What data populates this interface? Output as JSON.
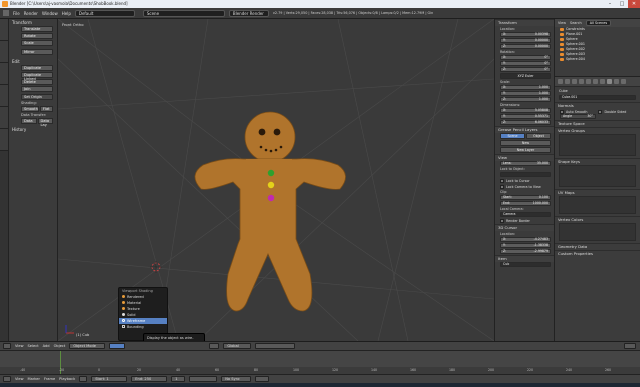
{
  "window": {
    "title": "Blender [C:\\Users\\aj-vasmola\\Documents\\ShobBook.blend]",
    "min": "–",
    "max": "□",
    "close": "✕"
  },
  "infobar": {
    "menus": [
      "File",
      "Render",
      "Window",
      "Help"
    ],
    "layout": "Default",
    "scene": "Scene",
    "engine": "Blender Render",
    "stats": "v2.79 | Verts:29,050 | Faces:28,038 | Tris:56,076 | Objects:0/8 | Lamps:0/2 | Mem:12.79M | Gin"
  },
  "toolshelf": {
    "transform_header": "Transform",
    "transform": [
      "Translate",
      "Rotate",
      "Scale",
      "Mirror"
    ],
    "edit_header": "Edit",
    "edit": [
      "Duplicate",
      "Duplicate Linked",
      "Delete",
      "Join"
    ],
    "set_origin": "Set Origin",
    "shading_label": "Shading:",
    "shading": [
      "Smooth",
      "Flat"
    ],
    "data_transfer_label": "Data Transfer:",
    "data_transfer": [
      "Data",
      "Data Lay"
    ],
    "history": "History"
  },
  "viewport": {
    "label": "Front Ortho",
    "object_label": "(1) Cub"
  },
  "shading_menu": {
    "title": "Viewport Shading",
    "items": [
      "Rendered",
      "Material",
      "Texture",
      "Solid",
      "Wireframe",
      "Bounding"
    ],
    "selected": "Wireframe"
  },
  "tooltip": "Display the object as wire-edges.",
  "npanel": {
    "transform": "Transform",
    "location": "Location:",
    "loc": [
      [
        "X:",
        "0.00398"
      ],
      [
        "Y:",
        "0.00000"
      ],
      [
        "Z:",
        "0.00000"
      ]
    ],
    "rotation": "Rotation:",
    "rot": [
      [
        "X:",
        "0°"
      ],
      [
        "Y:",
        "0°"
      ],
      [
        "Z:",
        "0°"
      ]
    ],
    "euler": "XYZ Euler",
    "scale": "Scale:",
    "scl": [
      [
        "X:",
        "1.000"
      ],
      [
        "Y:",
        "1.000"
      ],
      [
        "Z:",
        "1.000"
      ]
    ],
    "dimensions": "Dimensions:",
    "dim": [
      [
        "X:",
        "5.05808"
      ],
      [
        "Y:",
        "0.55371"
      ],
      [
        "Z:",
        "6.06033"
      ]
    ],
    "grease": "Grease Pencil Layers",
    "scene_btn": "Scene",
    "object_btn": "Object",
    "new": "New",
    "new_layer": "New Layer",
    "view": "View",
    "lens": [
      "Lens:",
      "35.000"
    ],
    "lock_object": "Lock to Object:",
    "lock_cursor": "Lock to Cursor",
    "lock_camera": "Lock Camera to View",
    "clip": "Clip:",
    "clip_start": [
      "Start:",
      "0.100"
    ],
    "clip_end": [
      "End:",
      "1000.000"
    ],
    "local_camera": "Local Camera:",
    "camera": "Camera",
    "render_border": "Render Border",
    "cursor": "3D Cursor",
    "cur_location": "Location:",
    "cur": [
      [
        "X:",
        "-4.27483"
      ],
      [
        "Y:",
        "-1.38338"
      ],
      [
        "Z:",
        "-2.99879"
      ]
    ],
    "item": "Item",
    "item_name": "Cub"
  },
  "outliner": {
    "view": "View",
    "search": "Search",
    "filter": "All Scenes",
    "items": [
      "Constraints",
      "Plane.001",
      "Sphere",
      "Sphere.001",
      "Sphere.002",
      "Sphere.003",
      "Sphere.004"
    ]
  },
  "props": {
    "breadcrumb": "Cube",
    "mesh_name": "Cube.001",
    "normals": "Normals",
    "auto_smooth": "Auto Smooth",
    "double_sided": "Double Sided",
    "angle": "Angle",
    "angle_val": "30°",
    "texture_space": "Texture Space",
    "vertex_groups": "Vertex Groups",
    "shape_keys": "Shape Keys",
    "uv_maps": "UV Maps",
    "vertex_colors": "Vertex Colors",
    "geometry_data": "Geometry Data",
    "custom_props": "Custom Properties"
  },
  "view_header": {
    "items": [
      "View",
      "Select",
      "Add",
      "Object"
    ],
    "mode": "Object Mode",
    "global": "Global",
    "layers_label": ""
  },
  "timeline_header": {
    "items": [
      "View",
      "Marker",
      "Frame",
      "Playback"
    ],
    "start_label": "Start:",
    "start": "1",
    "end_label": "End:",
    "end": "250",
    "current": "1",
    "sync": "No Sync"
  },
  "timeline_ticks": [
    "-40",
    "-20",
    "0",
    "20",
    "40",
    "60",
    "80",
    "100",
    "120",
    "140",
    "160",
    "180",
    "200",
    "220",
    "240",
    "260"
  ],
  "colors": {
    "body": "#b0742c",
    "button_green": "#2ea02e",
    "button_yellow": "#e4d21a",
    "button_magenta": "#c02ab0",
    "face": "#2a1a0a"
  }
}
